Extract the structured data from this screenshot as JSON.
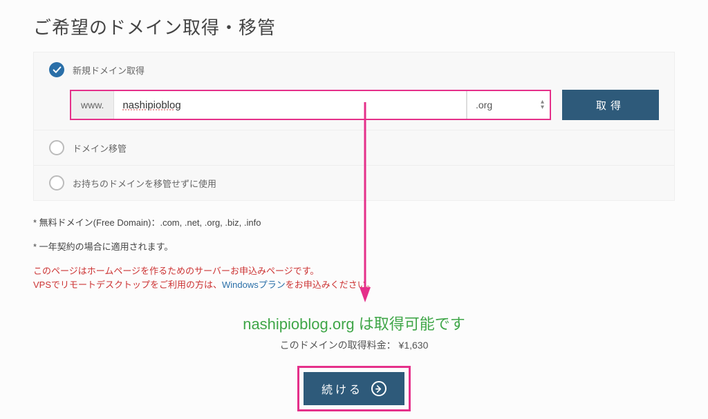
{
  "title": "ご希望のドメイン取得・移管",
  "options": {
    "new": {
      "label": "新規ドメイン取得",
      "checked": true
    },
    "transfer": {
      "label": "ドメイン移管"
    },
    "existing": {
      "label": "お持ちのドメインを移管せずに使用"
    }
  },
  "domain_form": {
    "prefix": "www.",
    "value": "nashipioblog",
    "tld": ".org",
    "acquire_label": "取得"
  },
  "notes": {
    "line1": "* 無料ドメイン(Free Domain)：.com, .net, .org, .biz, .info",
    "line2": "* 一年契約の場合に適用されます。"
  },
  "warning": {
    "text1": "このページはホームページを作るためのサーバーお申込みページです。",
    "text2_a": "VPSでリモートデスクトップをご利用の方は、",
    "link": "Windowsプラン",
    "text2_b": "をお申込みください。"
  },
  "result": {
    "available_text": "nashipioblog.org は取得可能です",
    "price_label": "このドメインの取得料金：",
    "price": "¥1,630"
  },
  "continue_label": "続ける"
}
